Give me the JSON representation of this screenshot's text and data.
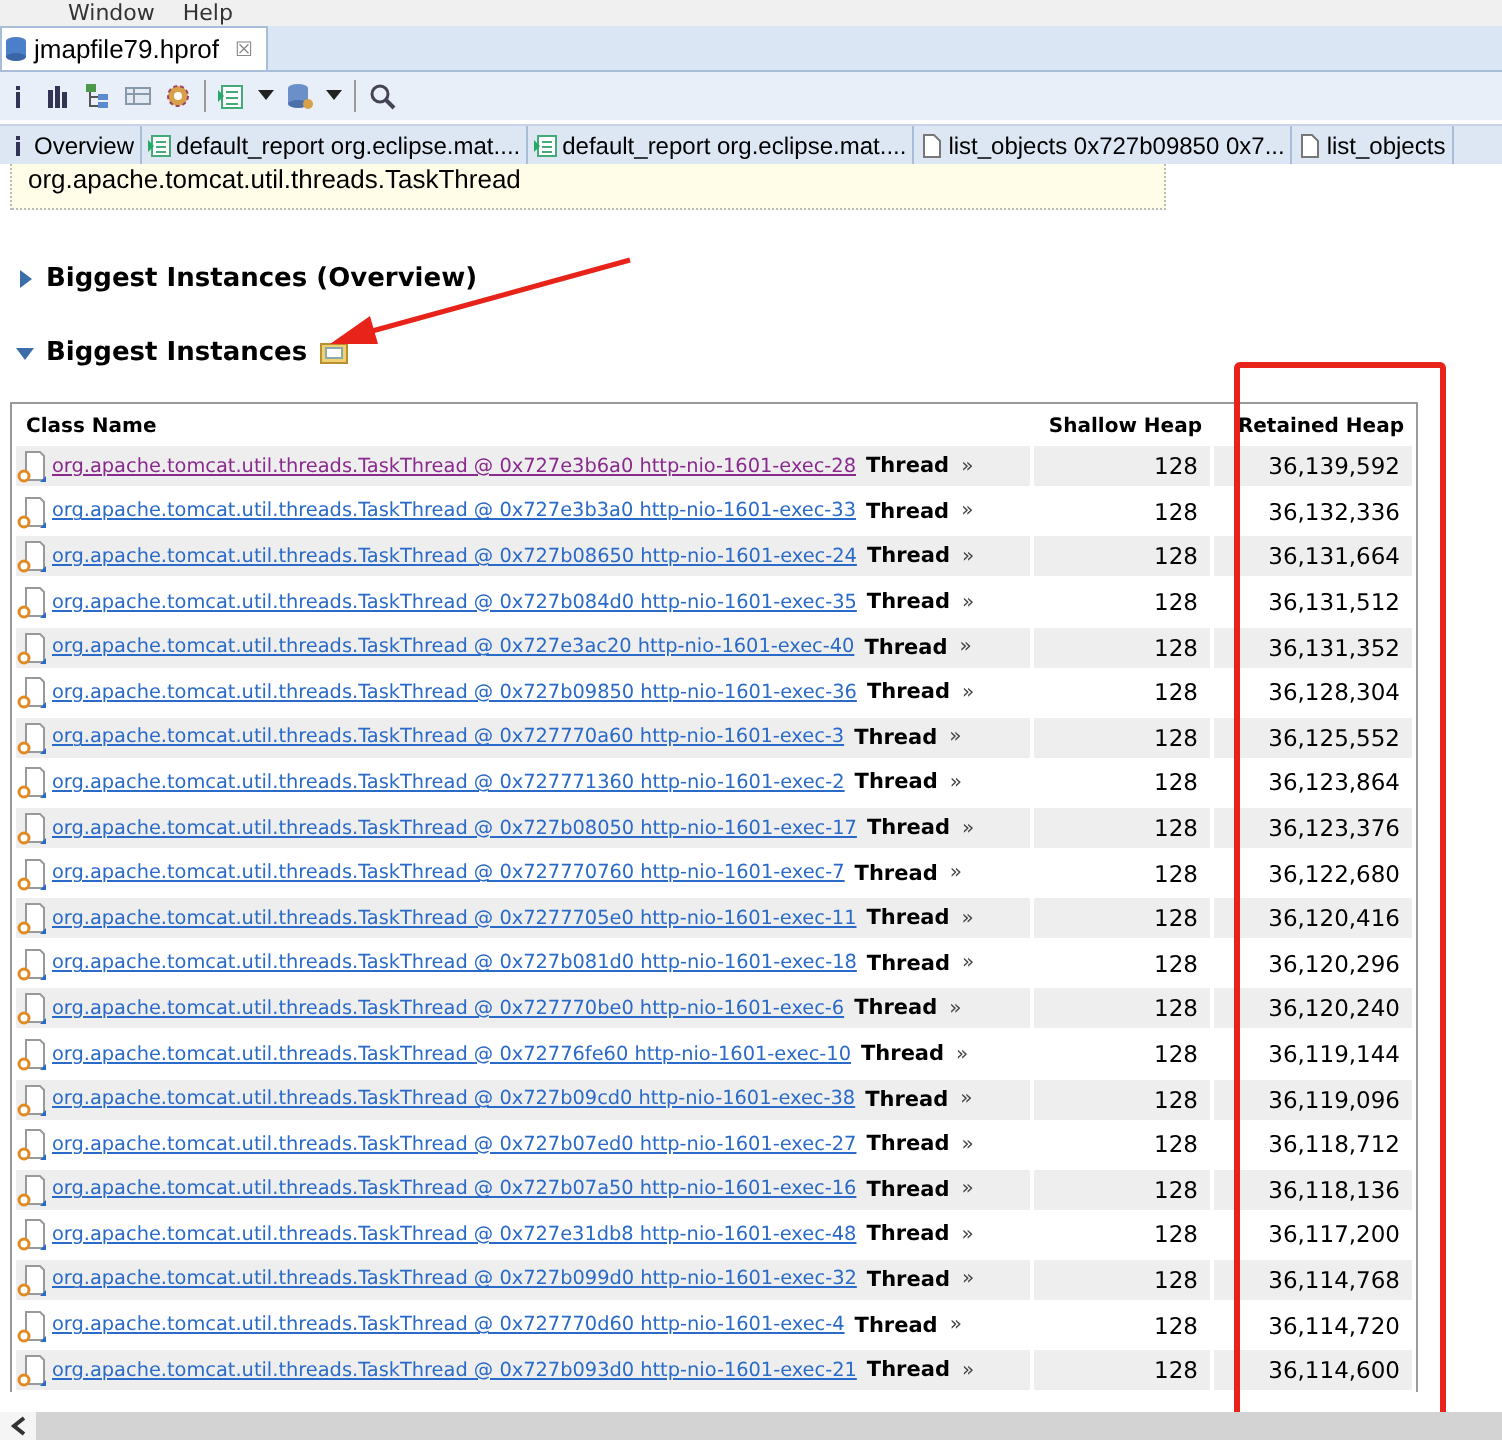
{
  "menu": [
    "Window",
    "Help"
  ],
  "editor_tab": {
    "title": "jmapfile79.hprof",
    "close": "☒"
  },
  "subtabs": [
    {
      "label": "Overview",
      "kind": "info"
    },
    {
      "label": "default_report  org.eclipse.mat....",
      "kind": "report"
    },
    {
      "label": "default_report  org.eclipse.mat....",
      "kind": "report"
    },
    {
      "label": "list_objects  0x727b09850 0x7...",
      "kind": "list"
    },
    {
      "label": "list_objects",
      "kind": "list"
    }
  ],
  "info_box": "org.apache.tomcat.util.threads.TaskThread",
  "sections": [
    {
      "title": "Biggest Instances (Overview)",
      "expanded": false
    },
    {
      "title": "Biggest Instances",
      "expanded": true
    }
  ],
  "table": {
    "columns": [
      "Class Name",
      "Shallow Heap",
      "Retained Heap"
    ],
    "rows": [
      {
        "object": "org.apache.tomcat.util.threads.TaskThread @ 0x727e3b6a0 http-nio-1601-exec-28",
        "type": "Thread",
        "more": "»",
        "shallow": "128",
        "retained": "36,139,592",
        "visited": true
      },
      {
        "object": "org.apache.tomcat.util.threads.TaskThread @ 0x727e3b3a0 http-nio-1601-exec-33",
        "type": "Thread",
        "more": "»",
        "shallow": "128",
        "retained": "36,132,336",
        "visited": false
      },
      {
        "object": "org.apache.tomcat.util.threads.TaskThread @ 0x727b08650 http-nio-1601-exec-24",
        "type": "Thread",
        "more": "»",
        "shallow": "128",
        "retained": "36,131,664",
        "visited": false
      },
      {
        "object": "org.apache.tomcat.util.threads.TaskThread @ 0x727b084d0 http-nio-1601-exec-35",
        "type": "Thread",
        "more": "»",
        "shallow": "128",
        "retained": "36,131,512",
        "visited": false
      },
      {
        "object": "org.apache.tomcat.util.threads.TaskThread @ 0x727e3ac20 http-nio-1601-exec-40",
        "type": "Thread",
        "more": "»",
        "shallow": "128",
        "retained": "36,131,352",
        "visited": false
      },
      {
        "object": "org.apache.tomcat.util.threads.TaskThread @ 0x727b09850 http-nio-1601-exec-36",
        "type": "Thread",
        "more": "»",
        "shallow": "128",
        "retained": "36,128,304",
        "visited": false
      },
      {
        "object": "org.apache.tomcat.util.threads.TaskThread @ 0x727770a60 http-nio-1601-exec-3",
        "type": "Thread",
        "more": "»",
        "shallow": "128",
        "retained": "36,125,552",
        "visited": false
      },
      {
        "object": "org.apache.tomcat.util.threads.TaskThread @ 0x727771360 http-nio-1601-exec-2",
        "type": "Thread",
        "more": "»",
        "shallow": "128",
        "retained": "36,123,864",
        "visited": false
      },
      {
        "object": "org.apache.tomcat.util.threads.TaskThread @ 0x727b08050 http-nio-1601-exec-17",
        "type": "Thread",
        "more": "»",
        "shallow": "128",
        "retained": "36,123,376",
        "visited": false
      },
      {
        "object": "org.apache.tomcat.util.threads.TaskThread @ 0x727770760 http-nio-1601-exec-7",
        "type": "Thread",
        "more": "»",
        "shallow": "128",
        "retained": "36,122,680",
        "visited": false
      },
      {
        "object": "org.apache.tomcat.util.threads.TaskThread @ 0x7277705e0 http-nio-1601-exec-11",
        "type": "Thread",
        "more": "»",
        "shallow": "128",
        "retained": "36,120,416",
        "visited": false
      },
      {
        "object": "org.apache.tomcat.util.threads.TaskThread @ 0x727b081d0 http-nio-1601-exec-18",
        "type": "Thread",
        "more": "»",
        "shallow": "128",
        "retained": "36,120,296",
        "visited": false
      },
      {
        "object": "org.apache.tomcat.util.threads.TaskThread @ 0x727770be0 http-nio-1601-exec-6",
        "type": "Thread",
        "more": "»",
        "shallow": "128",
        "retained": "36,120,240",
        "visited": false
      },
      {
        "object": "org.apache.tomcat.util.threads.TaskThread @ 0x72776fe60 http-nio-1601-exec-10",
        "type": "Thread",
        "more": "»",
        "shallow": "128",
        "retained": "36,119,144",
        "visited": false
      },
      {
        "object": "org.apache.tomcat.util.threads.TaskThread @ 0x727b09cd0 http-nio-1601-exec-38",
        "type": "Thread",
        "more": "»",
        "shallow": "128",
        "retained": "36,119,096",
        "visited": false
      },
      {
        "object": "org.apache.tomcat.util.threads.TaskThread @ 0x727b07ed0 http-nio-1601-exec-27",
        "type": "Thread",
        "more": "»",
        "shallow": "128",
        "retained": "36,118,712",
        "visited": false
      },
      {
        "object": "org.apache.tomcat.util.threads.TaskThread @ 0x727b07a50 http-nio-1601-exec-16",
        "type": "Thread",
        "more": "»",
        "shallow": "128",
        "retained": "36,118,136",
        "visited": false
      },
      {
        "object": "org.apache.tomcat.util.threads.TaskThread @ 0x727e31db8 http-nio-1601-exec-48",
        "type": "Thread",
        "more": "»",
        "shallow": "128",
        "retained": "36,117,200",
        "visited": false
      },
      {
        "object": "org.apache.tomcat.util.threads.TaskThread @ 0x727b099d0 http-nio-1601-exec-32",
        "type": "Thread",
        "more": "»",
        "shallow": "128",
        "retained": "36,114,768",
        "visited": false
      },
      {
        "object": "org.apache.tomcat.util.threads.TaskThread @ 0x727770d60 http-nio-1601-exec-4",
        "type": "Thread",
        "more": "»",
        "shallow": "128",
        "retained": "36,114,720",
        "visited": false
      },
      {
        "object": "org.apache.tomcat.util.threads.TaskThread @ 0x727b093d0 http-nio-1601-exec-21",
        "type": "Thread",
        "more": "»",
        "shallow": "128",
        "retained": "36,114,600",
        "visited": false
      }
    ]
  }
}
